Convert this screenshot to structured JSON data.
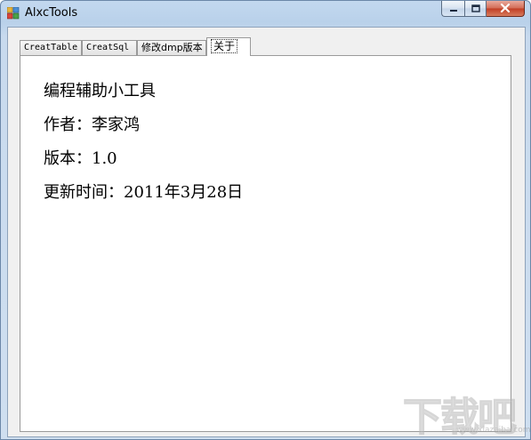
{
  "window": {
    "title": "AlxcTools"
  },
  "tabs": [
    {
      "label": "CreatTable",
      "active": false
    },
    {
      "label": "CreatSql",
      "active": false
    },
    {
      "label": "修改dmp版本",
      "active": false
    },
    {
      "label": "关于",
      "active": true
    }
  ],
  "about": {
    "app_name": "编程辅助小工具",
    "author": "作者：李家鸿",
    "version": "版本：1.0",
    "updated": "更新时间：2011年3月28日"
  },
  "watermark": {
    "text": "下载吧",
    "sub": "www.xiazaiba.com"
  },
  "colors": {
    "titlebar": "#b9d1ea",
    "close_button": "#c13d23",
    "tab_page_bg": "#ffffff",
    "client_bg": "#f0f0f0"
  },
  "icons": [
    "app-icon",
    "minimize-icon",
    "maximize-icon",
    "close-icon"
  ]
}
